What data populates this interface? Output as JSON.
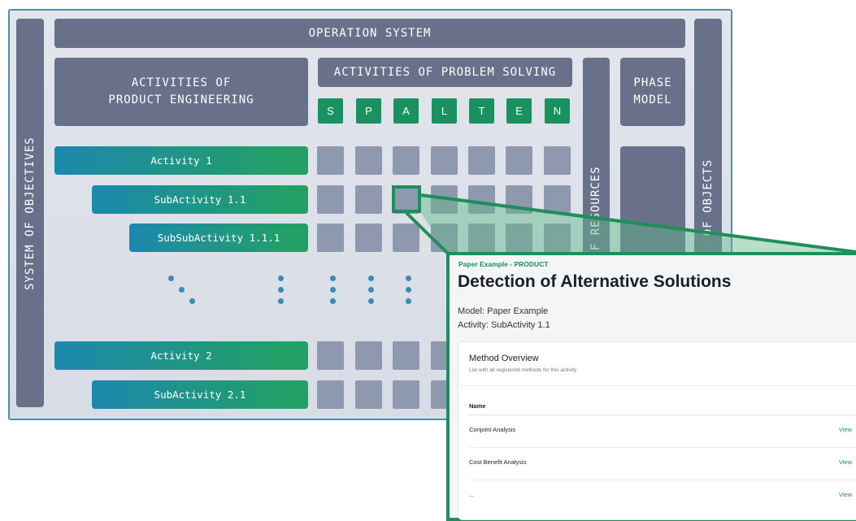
{
  "diagram": {
    "operation_system": "OPERATION SYSTEM",
    "product_engineering": "ACTIVITIES OF\nPRODUCT ENGINEERING",
    "problem_solving": "ACTIVITIES OF PROBLEM SOLVING",
    "phase_model": "PHASE\nMODEL",
    "system_of_objectives": "SYSTEM OF OBJECTIVES",
    "resources": "OF RESOURCES",
    "objects": "OF OBJECTS",
    "spalten": [
      "S",
      "P",
      "A",
      "L",
      "T",
      "E",
      "N"
    ],
    "activities": [
      "Activity 1",
      "SubActivity 1.1",
      "SubSubActivity 1.1.1",
      "Activity 2",
      "SubActivity 2.1"
    ]
  },
  "panel": {
    "breadcrumb": "Paper Example - PRODUCT",
    "title": "Detection of Alternative Solutions",
    "model": "Model: Paper Example",
    "activity": "Activity: SubActivity 1.1",
    "card_title": "Method Overview",
    "card_subtitle": "List with all registered methods for this activity",
    "column_name": "Name",
    "rows": [
      {
        "name": "Conjoint Analysis",
        "action": "View"
      },
      {
        "name": "Cost Benefit Analysis",
        "action": "View"
      },
      {
        "name": "...",
        "action": "View"
      }
    ]
  },
  "colors": {
    "accent_green": "#1e8e5a",
    "bar_gray": "#687189",
    "cell_gray": "#8e98ae",
    "frame_blue": "#4e8fb0"
  }
}
